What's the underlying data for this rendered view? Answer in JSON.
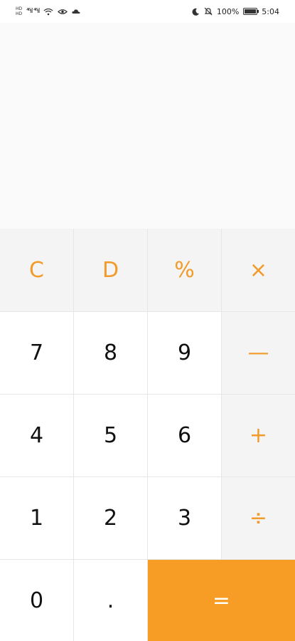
{
  "status_bar": {
    "sim1": "HD",
    "sim2": "HD",
    "signal_left": "⁴⁶ıl ⁴⁶ıl",
    "battery_percent": "100%",
    "time": "5:04",
    "battery_level": 1.0
  },
  "display": {
    "expression": "",
    "result": ""
  },
  "keys": {
    "clear": "C",
    "delete": "D",
    "percent": "%",
    "multiply": "×",
    "seven": "7",
    "eight": "8",
    "nine": "9",
    "subtract": "—",
    "four": "4",
    "five": "5",
    "six": "6",
    "add": "+",
    "one": "1",
    "two": "2",
    "three": "3",
    "divide": "÷",
    "zero": "0",
    "decimal": ".",
    "equals": "="
  },
  "colors": {
    "accent": "#f29b2a",
    "equals_bg": "#f79c25",
    "func_bg": "#f4f4f4",
    "key_bg": "#ffffff",
    "display_bg": "#fafafa"
  },
  "icons": [
    "sim-badge-icon",
    "signal-icon",
    "wifi-icon",
    "eye-icon",
    "cloud-icon",
    "moon-icon",
    "bell-muted-icon",
    "battery-icon"
  ]
}
